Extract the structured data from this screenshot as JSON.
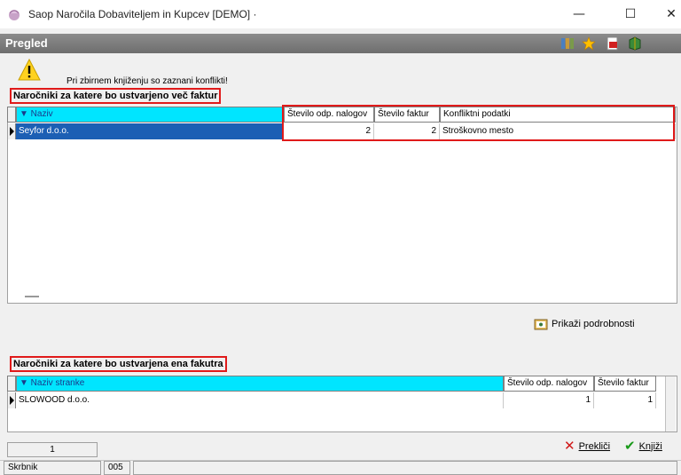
{
  "window": {
    "title": "Saop  Naročila Dobaviteljem in Kupcev [DEMO] ·",
    "minimize": "—",
    "maximize": "☐",
    "close": "✕"
  },
  "header": {
    "title": "Pregled",
    "icons": [
      "columns-icon",
      "star-icon",
      "pdf-icon",
      "book-icon"
    ]
  },
  "warning": {
    "text": "Pri zbirnem knjiženju so zaznani konflikti!"
  },
  "section_multi": {
    "title": "Naročniki za katere bo ustvarjeno več faktur",
    "columns": [
      "▼ Naziv",
      "Število odp. nalogov",
      "Število faktur",
      "Konfliktni podatki"
    ],
    "rows": [
      {
        "naziv": "Seyfor d.o.o.",
        "nalogi": "2",
        "fakture": "2",
        "konflikt": "Stroškovno mesto"
      }
    ]
  },
  "details_button": "Prikaži podrobnosti",
  "section_single": {
    "title": "Naročniki za katere bo ustvarjena ena fakutra",
    "columns": [
      "▼ Naziv stranke",
      "Število odp. nalogov",
      "Število faktur"
    ],
    "rows": [
      {
        "naziv": "SLOWOOD d.o.o.",
        "nalogi": "1",
        "fakture": "1"
      }
    ]
  },
  "page_counter": "1",
  "buttons": {
    "cancel": "Prekliči",
    "book": "Knjiži"
  },
  "statusbar": {
    "user": "Skrbnik",
    "code": "005"
  }
}
